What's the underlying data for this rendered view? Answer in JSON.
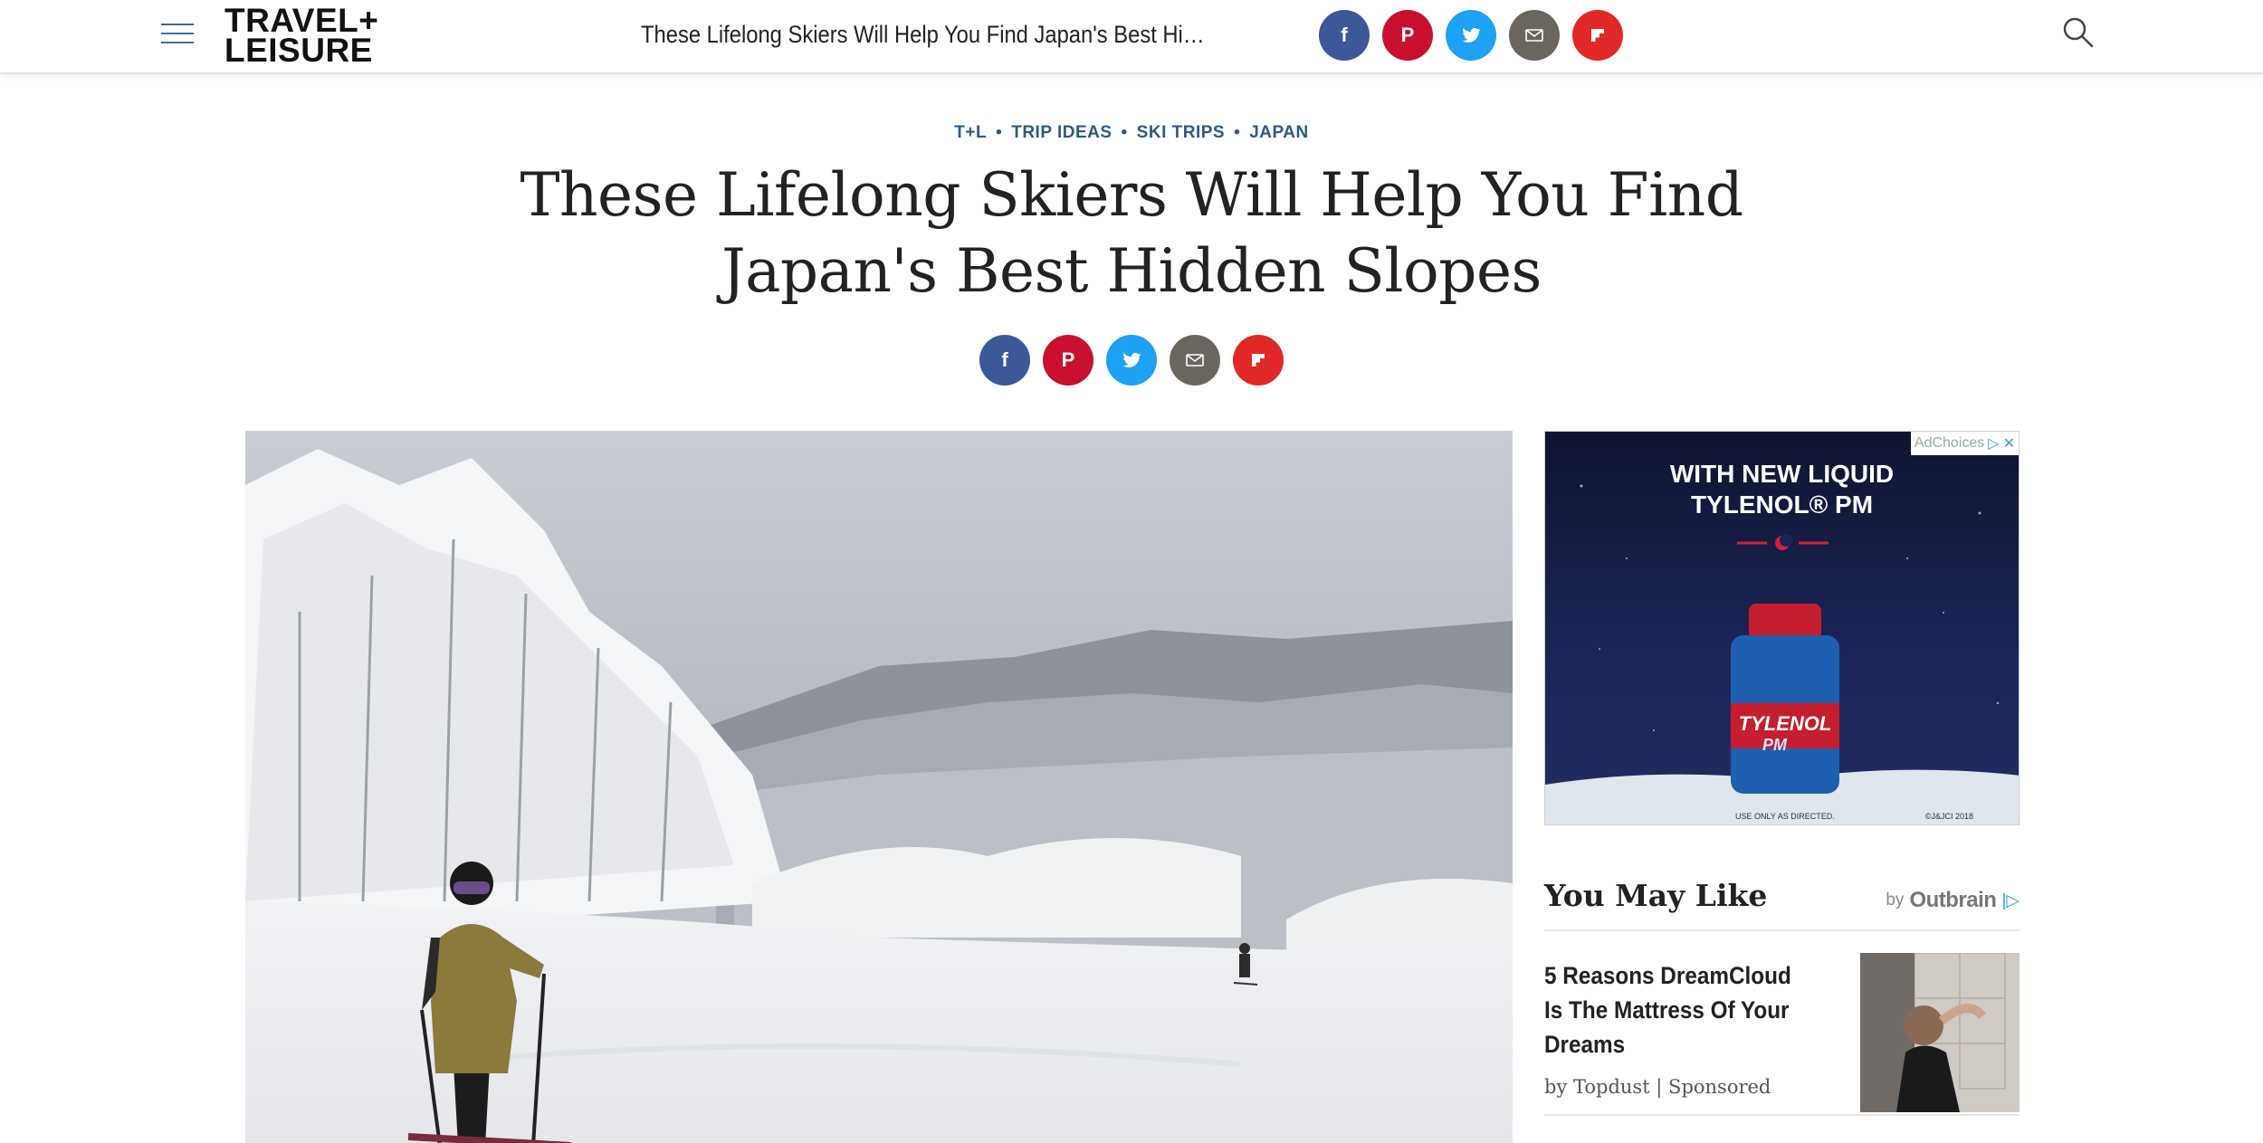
{
  "header": {
    "logo": [
      "TRAVEL+",
      "LEISURE"
    ],
    "title": "These Lifelong Skiers Will Help You Find Japan's Best Hidden Sl…"
  },
  "share": [
    {
      "name": "facebook",
      "label": "f",
      "color": "#3b5998"
    },
    {
      "name": "pinterest",
      "label": "P",
      "color": "#c8102e"
    },
    {
      "name": "twitter",
      "label": "t",
      "color": "#1da1f2"
    },
    {
      "name": "email",
      "label": "",
      "color": "#6b6560"
    },
    {
      "name": "flipboard",
      "label": "",
      "color": "#e12828"
    }
  ],
  "breadcrumb": [
    "T+L",
    "TRIP IDEAS",
    "SKI TRIPS",
    "JAPAN"
  ],
  "headline": "These Lifelong Skiers Will Help You Find Japan's Best Hidden Slopes",
  "ad": {
    "choices": "AdChoices",
    "headline_line1": "WITH NEW LIQUID",
    "headline_line2": "TYLENOL® PM",
    "brand": "TYLENOL",
    "sub": "PM",
    "footer_left": "USE ONLY AS DIRECTED.",
    "footer_right": "©J&JCI 2018"
  },
  "you_may_like": {
    "title": "You May Like",
    "by": "by",
    "provider": "Outbrain",
    "items": [
      {
        "title": "5 Reasons DreamCloud Is The Mattress Of Your Dreams",
        "meta": "by Topdust | Sponsored"
      }
    ]
  }
}
